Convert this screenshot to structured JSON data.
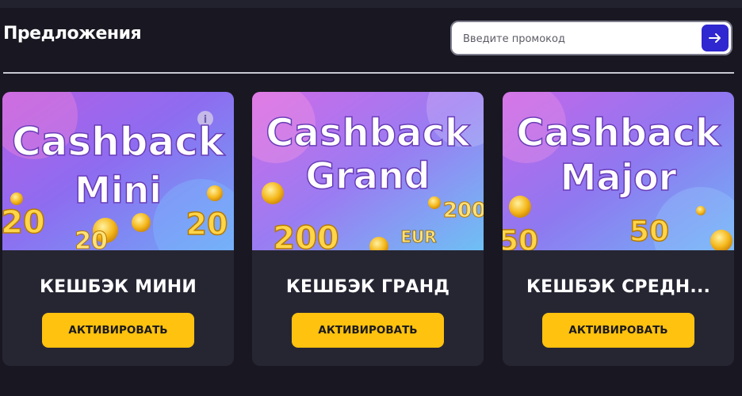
{
  "page": {
    "title": "Предложения",
    "promo": {
      "placeholder": "Введите промокод"
    }
  },
  "offers": [
    {
      "banner_line1": "Cashback",
      "banner_line2": "Mini",
      "numbers": [
        "20",
        "20",
        "20"
      ],
      "title": "КЕШБЭК МИНИ",
      "button_label": "АКТИВИРОВАТЬ"
    },
    {
      "banner_line1": "Cashback",
      "banner_line2": "Grand",
      "numbers": [
        "200",
        "200",
        "EUR"
      ],
      "title": "КЕШБЭК ГРАНД",
      "button_label": "АКТИВИРОВАТЬ"
    },
    {
      "banner_line1": "Cashback",
      "banner_line2": "Major",
      "numbers": [
        "50",
        "50"
      ],
      "title": "КЕШБЭК СРЕДН...",
      "button_label": "АКТИВИРОВАТЬ"
    }
  ],
  "colors": {
    "background": "#191822",
    "card": "#262633",
    "button": "#ffc20e",
    "promo_submit": "#2f27cf"
  }
}
